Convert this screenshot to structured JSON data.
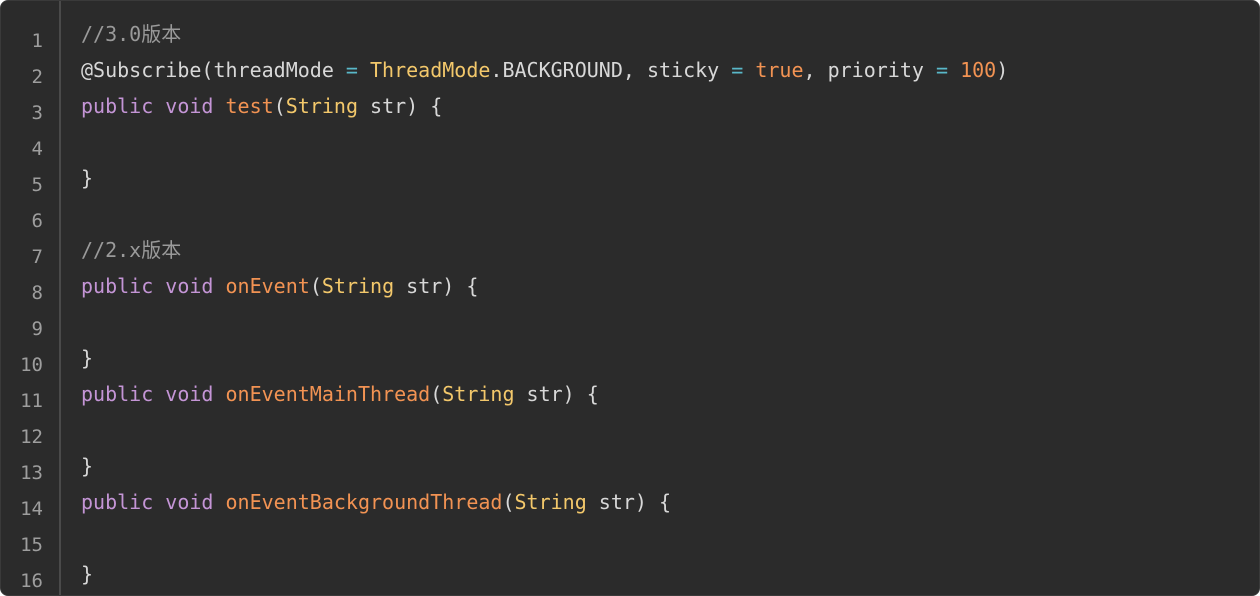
{
  "editor": {
    "line_numbers": [
      "1",
      "2",
      "3",
      "4",
      "5",
      "6",
      "7",
      "8",
      "9",
      "10",
      "11",
      "12",
      "13",
      "14",
      "15",
      "16"
    ],
    "lines": [
      [
        {
          "t": "//3.0版本",
          "c": "comment"
        }
      ],
      [
        {
          "t": "@Subscribe(threadMode ",
          "c": "plain"
        },
        {
          "t": "=",
          "c": "op"
        },
        {
          "t": " ",
          "c": "plain"
        },
        {
          "t": "ThreadMode",
          "c": "class"
        },
        {
          "t": ".BACKGROUND, sticky ",
          "c": "plain"
        },
        {
          "t": "=",
          "c": "op"
        },
        {
          "t": " ",
          "c": "plain"
        },
        {
          "t": "true",
          "c": "literal"
        },
        {
          "t": ", priority ",
          "c": "plain"
        },
        {
          "t": "=",
          "c": "op"
        },
        {
          "t": " ",
          "c": "plain"
        },
        {
          "t": "100",
          "c": "literal"
        },
        {
          "t": ")",
          "c": "plain"
        }
      ],
      [
        {
          "t": "public",
          "c": "keyword"
        },
        {
          "t": " ",
          "c": "plain"
        },
        {
          "t": "void",
          "c": "keyword"
        },
        {
          "t": " ",
          "c": "plain"
        },
        {
          "t": "test",
          "c": "func"
        },
        {
          "t": "(",
          "c": "plain"
        },
        {
          "t": "String",
          "c": "class"
        },
        {
          "t": " str) {",
          "c": "plain"
        }
      ],
      [],
      [
        {
          "t": "}",
          "c": "plain"
        }
      ],
      [],
      [
        {
          "t": "//2.x版本",
          "c": "comment"
        }
      ],
      [
        {
          "t": "public",
          "c": "keyword"
        },
        {
          "t": " ",
          "c": "plain"
        },
        {
          "t": "void",
          "c": "keyword"
        },
        {
          "t": " ",
          "c": "plain"
        },
        {
          "t": "onEvent",
          "c": "func"
        },
        {
          "t": "(",
          "c": "plain"
        },
        {
          "t": "String",
          "c": "class"
        },
        {
          "t": " str) {",
          "c": "plain"
        }
      ],
      [],
      [
        {
          "t": "}",
          "c": "plain"
        }
      ],
      [
        {
          "t": "public",
          "c": "keyword"
        },
        {
          "t": " ",
          "c": "plain"
        },
        {
          "t": "void",
          "c": "keyword"
        },
        {
          "t": " ",
          "c": "plain"
        },
        {
          "t": "onEventMainThread",
          "c": "func"
        },
        {
          "t": "(",
          "c": "plain"
        },
        {
          "t": "String",
          "c": "class"
        },
        {
          "t": " str) {",
          "c": "plain"
        }
      ],
      [],
      [
        {
          "t": "}",
          "c": "plain"
        }
      ],
      [
        {
          "t": "public",
          "c": "keyword"
        },
        {
          "t": " ",
          "c": "plain"
        },
        {
          "t": "void",
          "c": "keyword"
        },
        {
          "t": " ",
          "c": "plain"
        },
        {
          "t": "onEventBackgroundThread",
          "c": "func"
        },
        {
          "t": "(",
          "c": "plain"
        },
        {
          "t": "String",
          "c": "class"
        },
        {
          "t": " str) {",
          "c": "plain"
        }
      ],
      [],
      [
        {
          "t": "}",
          "c": "plain"
        }
      ]
    ]
  },
  "colors": {
    "background": "#2b2b2b",
    "comment": "#9a9a9a",
    "keyword": "#c495d6",
    "function": "#f29353",
    "class": "#f3c86b",
    "literal": "#f29353",
    "operator": "#59b8c9",
    "plain": "#d8d8d8",
    "line_number": "#9e9e9e"
  }
}
